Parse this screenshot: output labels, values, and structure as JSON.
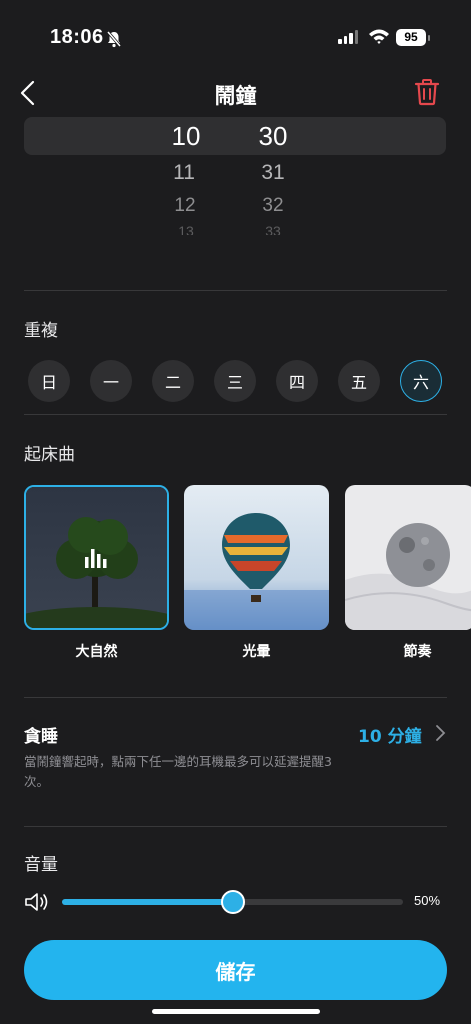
{
  "status": {
    "time": "18:06",
    "battery": "95"
  },
  "header": {
    "title": "鬧鐘"
  },
  "picker": {
    "hours": [
      "10",
      "11",
      "12",
      "13"
    ],
    "minutes": [
      "30",
      "31",
      "32",
      "33"
    ]
  },
  "repeat": {
    "label": "重複",
    "days": [
      "日",
      "一",
      "二",
      "三",
      "四",
      "五",
      "六"
    ],
    "selected_day": "六"
  },
  "ringtone": {
    "label": "起床曲",
    "items": [
      {
        "name": "大自然",
        "selected": true
      },
      {
        "name": "光暈",
        "selected": false
      },
      {
        "name": "節奏",
        "selected": false
      }
    ]
  },
  "snooze": {
    "title": "貪睡",
    "value": "10 分鐘",
    "description": "當鬧鐘響起時，點兩下任一邊的耳機最多可以延遲提醒3次。"
  },
  "volume": {
    "label": "音量",
    "level": 0.5,
    "percent_text": "50%"
  },
  "save_label": "儲存",
  "colors": {
    "accent": "#23b4ee",
    "background": "#1c1c1e",
    "trash": "#e5484d"
  }
}
